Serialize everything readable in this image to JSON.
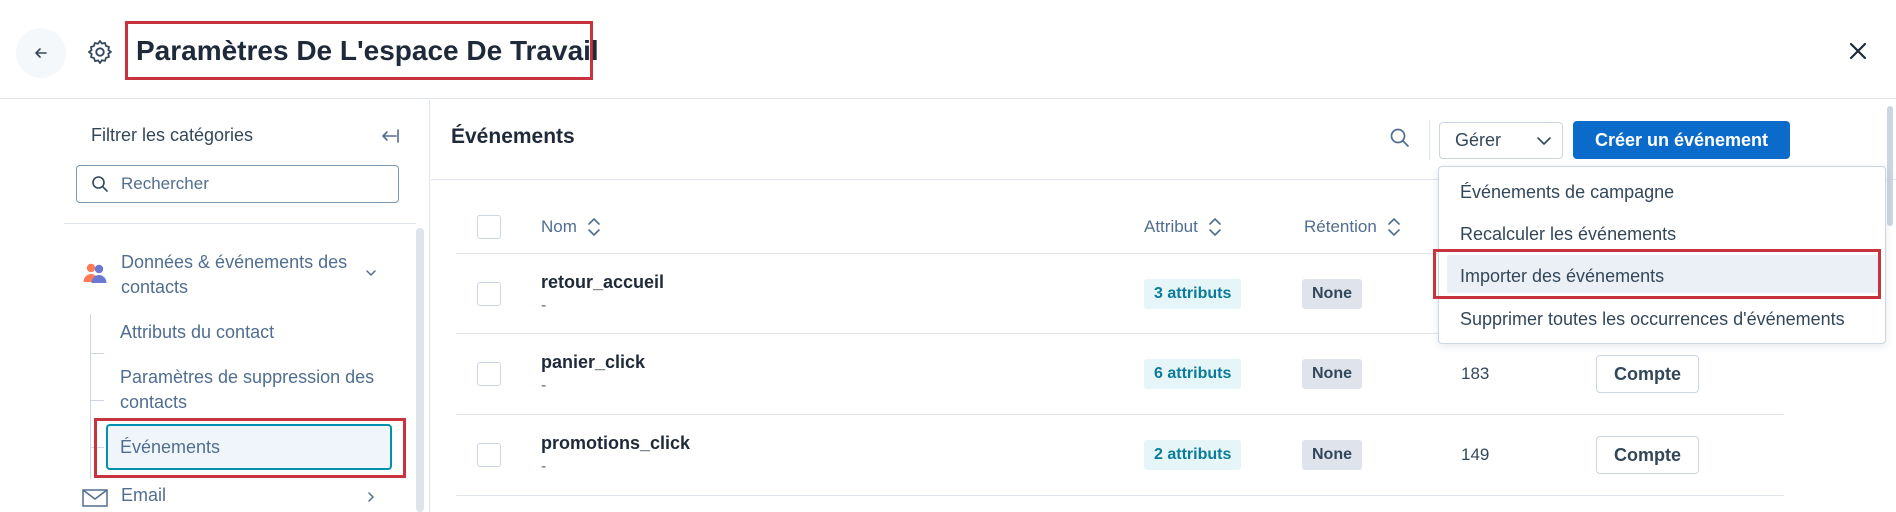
{
  "header": {
    "title": "Paramètres De L'espace De Travail"
  },
  "sidebar": {
    "filter_label": "Filtrer les catégories",
    "search_placeholder": "Rechercher",
    "category": {
      "label": "Données & événements des contacts",
      "items": [
        {
          "label": "Attributs du contact"
        },
        {
          "label": "Paramètres de suppression des contacts"
        },
        {
          "label": "Événements"
        }
      ]
    },
    "email_label": "Email"
  },
  "main": {
    "title": "Événements",
    "manage_label": "Gérer",
    "create_label": "Créer un événement",
    "columns": {
      "name": "Nom",
      "attribute": "Attribut",
      "retention": "Rétention"
    },
    "rows": [
      {
        "name": "retour_accueil",
        "sub": "-",
        "attributes": "3 attributs",
        "retention": "None"
      },
      {
        "name": "panier_click",
        "sub": "-",
        "attributes": "6 attributs",
        "retention": "None",
        "count": "183",
        "action": "Compte"
      },
      {
        "name": "promotions_click",
        "sub": "-",
        "attributes": "2 attributs",
        "retention": "None",
        "count": "149",
        "action": "Compte"
      }
    ]
  },
  "dropdown": {
    "items": [
      {
        "label": "Événements de campagne"
      },
      {
        "label": "Recalculer les événements"
      },
      {
        "label": "Importer des événements"
      },
      {
        "label": "Supprimer toutes les occurrences d'événements"
      }
    ],
    "highlighted_index": 2
  },
  "colors": {
    "accent": "#0b6bcb",
    "highlight_outline": "#c8343e",
    "selection_border": "#0091ae"
  }
}
